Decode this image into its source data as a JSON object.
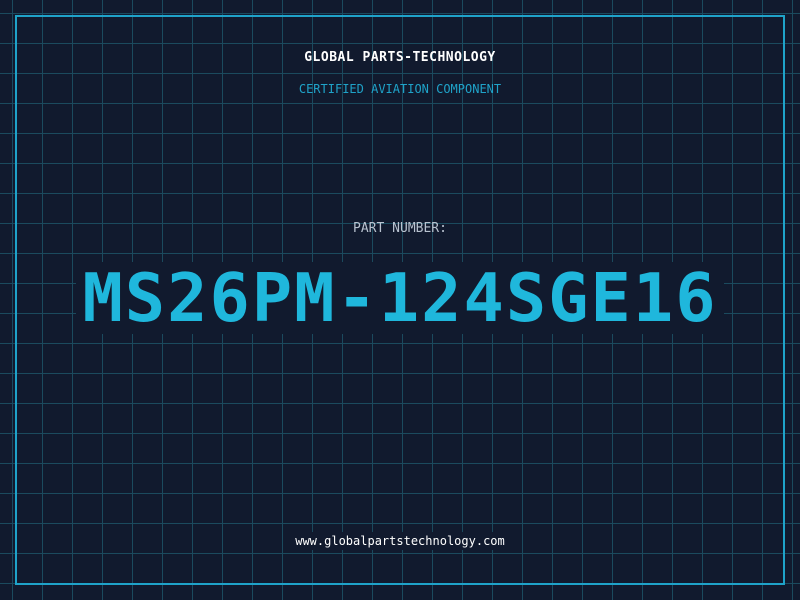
{
  "header": {
    "company": "GLOBAL PARTS-TECHNOLOGY",
    "subtitle": "CERTIFIED AVIATION COMPONENT"
  },
  "part": {
    "label": "PART NUMBER:",
    "number": "MS26PM-124SGE16"
  },
  "footer": {
    "website": "www.globalpartstechnology.com"
  },
  "colors": {
    "background": "#111a2e",
    "grid": "#1b4a5e",
    "accent": "#1fb7dc",
    "frame": "#1fa3c9"
  }
}
